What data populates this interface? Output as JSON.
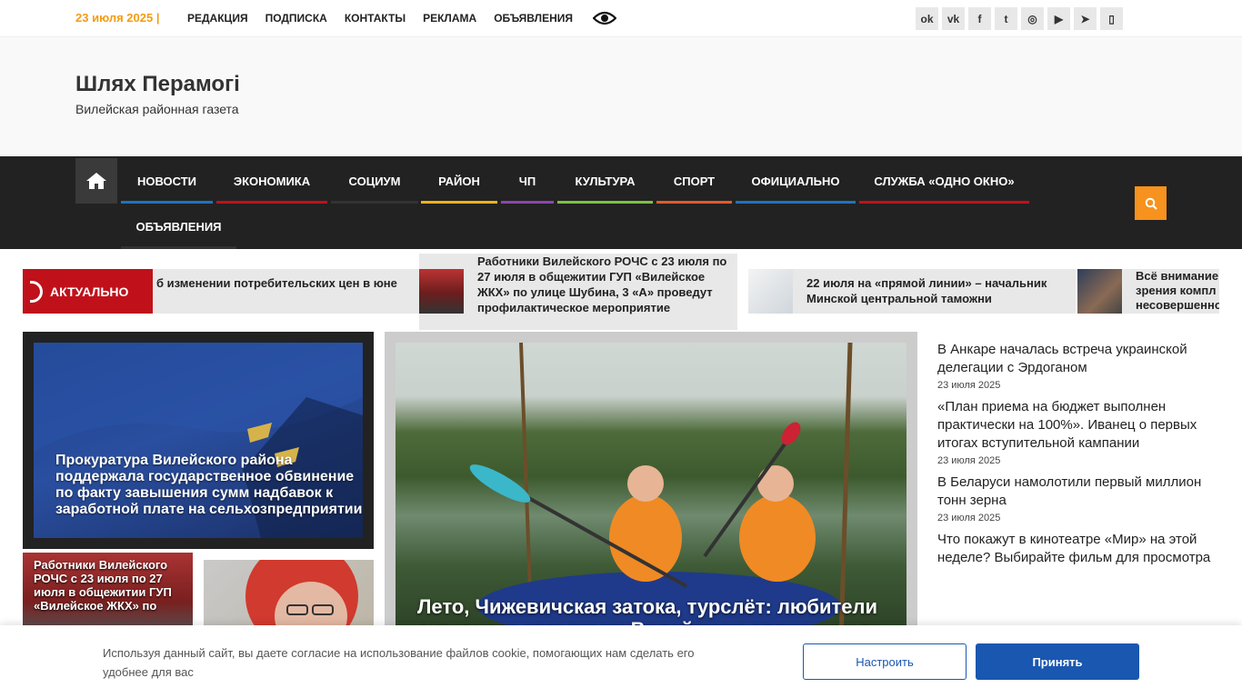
{
  "topbar": {
    "date": "23 июля 2025",
    "date_sep": "|",
    "links": [
      "РЕДАКЦИЯ",
      "ПОДПИСКА",
      "КОНТАКТЫ",
      "РЕКЛАМА",
      "ОБЪЯВЛЕНИЯ"
    ],
    "accessibility_icon": "eye-icon",
    "social": [
      {
        "icon": "odnoklassniki-icon",
        "glyph": "ok"
      },
      {
        "icon": "vk-icon",
        "glyph": "vk"
      },
      {
        "icon": "facebook-icon",
        "glyph": "f"
      },
      {
        "icon": "twitter-icon",
        "glyph": "t"
      },
      {
        "icon": "instagram-icon",
        "glyph": "◎"
      },
      {
        "icon": "youtube-icon",
        "glyph": "▶"
      },
      {
        "icon": "telegram-icon",
        "glyph": "➤"
      },
      {
        "icon": "phone-icon",
        "glyph": "▯"
      }
    ]
  },
  "header": {
    "title": "Шлях Перамогі",
    "subtitle": "Вилейская районная газета"
  },
  "nav": {
    "home_icon": "home-icon",
    "items": [
      {
        "label": "НОВОСТИ",
        "color": "#1e73be"
      },
      {
        "label": "ЭКОНОМИКА",
        "color": "#c0111a"
      },
      {
        "label": "СОЦИУМ",
        "color": "#333333"
      },
      {
        "label": "РАЙОН",
        "color": "#f3b01c"
      },
      {
        "label": "ЧП",
        "color": "#8e44ad"
      },
      {
        "label": "КУЛЬТУРА",
        "color": "#7ac143"
      },
      {
        "label": "СПОРТ",
        "color": "#e25b2c"
      },
      {
        "label": "ОФИЦИАЛЬНО",
        "color": "#1e73be"
      },
      {
        "label": "СЛУЖБА «ОДНО ОКНО»",
        "color": "#c0111a"
      },
      {
        "label": "ОБЪЯВЛЕНИЯ",
        "color": "#333333"
      }
    ],
    "search_icon": "search-icon"
  },
  "ticker": {
    "label": "АКТУАЛЬНО",
    "items": [
      {
        "text": "б изменении потребительских цен в юне"
      },
      {
        "text": "Работники Вилейского РОЧС с 23 июля по 27 июля  в общежитии ГУП «Вилейское ЖКХ» по улице Шубина, 3 «А» проведут профилактическое мероприятие"
      },
      {
        "text": "22 июля на «прямой линии» – начальник Минской центральной таможни"
      },
      {
        "text": "Всё внимание зрения компл несовершенно"
      }
    ]
  },
  "featured": {
    "left_title": "Прокуратура Вилейского района поддержала государственное обвинение по факту завышения сумм надбавок к заработной плате на сельхозпредприятии",
    "small_left_title": "Работники Вилейского РОЧС с 23 июля по 27 июля в общежитии ГУП «Вилейское ЖКХ» по",
    "center_title": "Лето, Чижевичская затока, турслёт: любители активного отдыха на Вилейщине соперничали"
  },
  "latest": [
    {
      "title": "В Анкаре началась встреча украинской делегации с Эрдоганом",
      "date": "23 июля 2025"
    },
    {
      "title": "«План приема на бюджет выполнен практически на 100%». Иванец о первых итогах вступительной кампании",
      "date": "23 июля 2025"
    },
    {
      "title": "В Беларуси намолотили первый миллион тонн зерна",
      "date": "23 июля 2025"
    },
    {
      "title": "Что покажут в кинотеатре «Мир» на этой неделе? Выбирайте фильм для просмотра",
      "date": ""
    }
  ],
  "cookie": {
    "text": "Используя данный сайт, вы даете согласие на использование файлов cookie, помогающих нам сделать его удобнее для вас",
    "settings_label": "Настроить",
    "accept_label": "Принять"
  }
}
